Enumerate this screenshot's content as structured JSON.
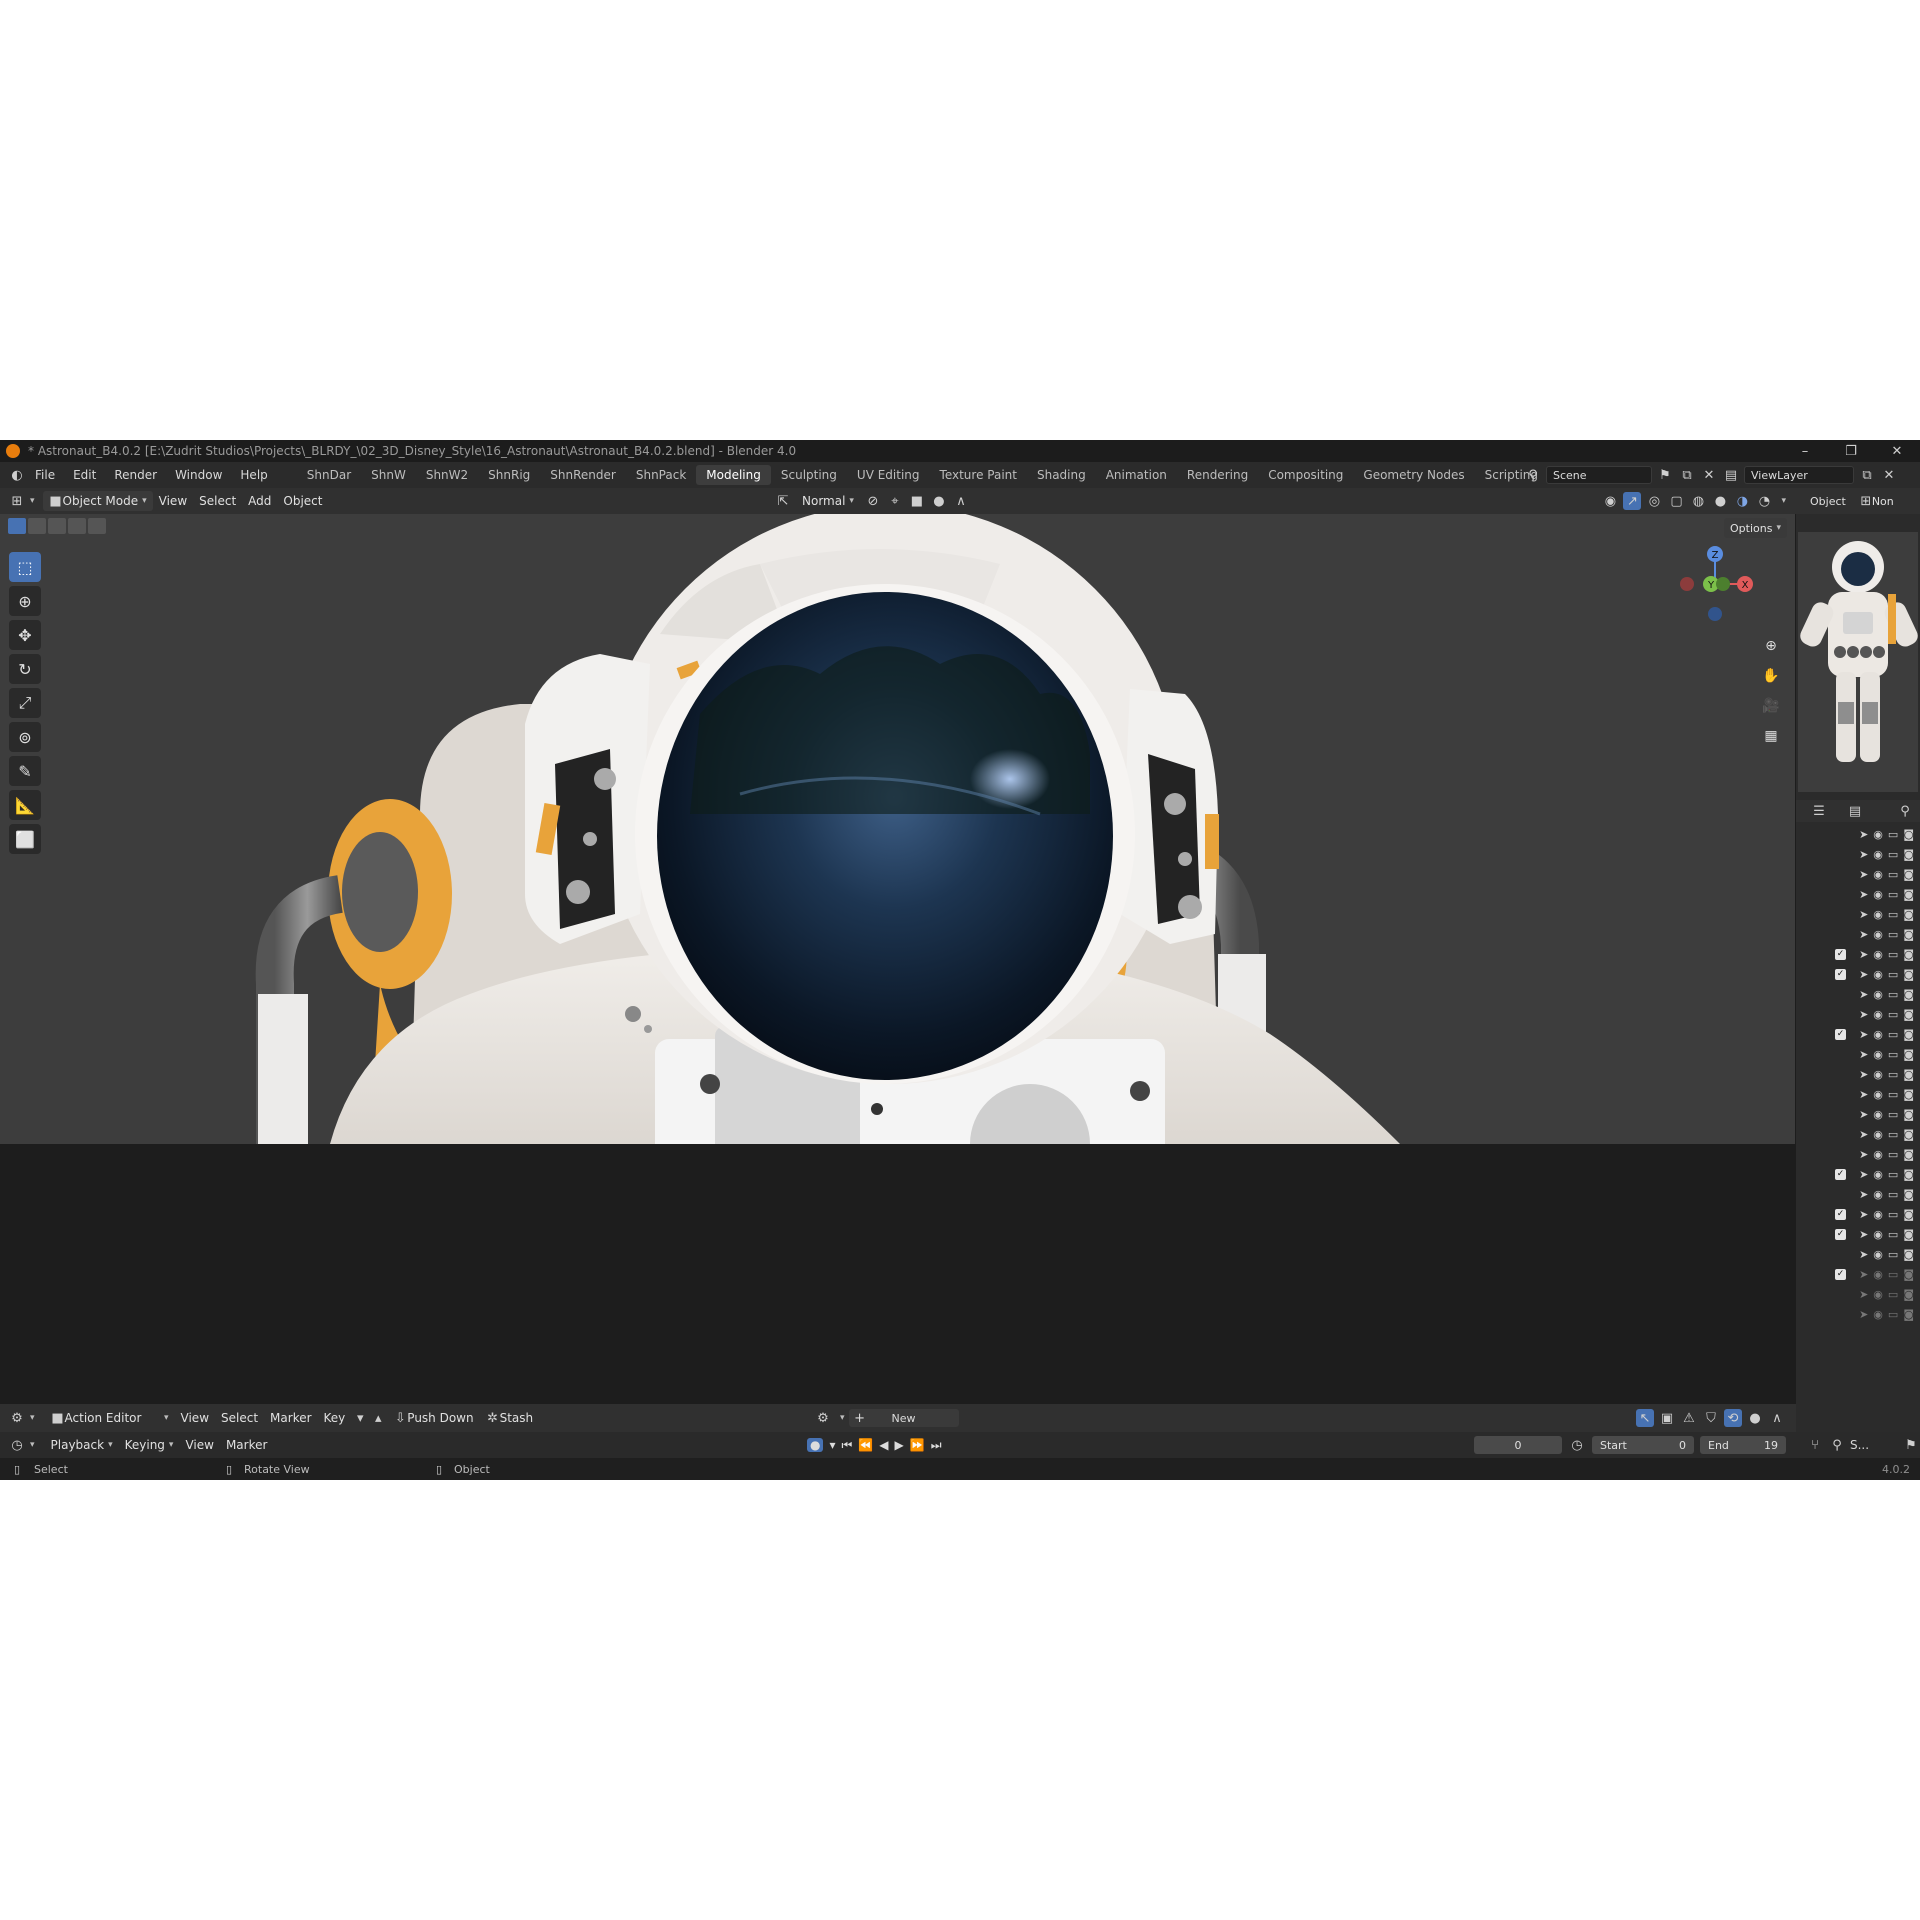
{
  "window": {
    "title": "* Astronaut_B4.0.2 [E:\\Zudrit Studios\\Projects\\_BLRDY_\\02_3D_Disney_Style\\16_Astronaut\\Astronaut_B4.0.2.blend] - Blender 4.0",
    "controls": [
      "–",
      "❐",
      "✕"
    ]
  },
  "menu": [
    "File",
    "Edit",
    "Render",
    "Window",
    "Help"
  ],
  "workspaces": [
    {
      "label": "ShnDar",
      "active": false
    },
    {
      "label": "ShnW",
      "active": false
    },
    {
      "label": "ShnW2",
      "active": false
    },
    {
      "label": "ShnRig",
      "active": false
    },
    {
      "label": "ShnRender",
      "active": false
    },
    {
      "label": "ShnPack",
      "active": false
    },
    {
      "label": "Modeling",
      "active": true
    },
    {
      "label": "Sculpting",
      "active": false
    },
    {
      "label": "UV Editing",
      "active": false
    },
    {
      "label": "Texture Paint",
      "active": false
    },
    {
      "label": "Shading",
      "active": false
    },
    {
      "label": "Animation",
      "active": false
    },
    {
      "label": "Rendering",
      "active": false
    },
    {
      "label": "Compositing",
      "active": false
    },
    {
      "label": "Geometry Nodes",
      "active": false
    },
    {
      "label": "Scripting",
      "active": false
    }
  ],
  "scene": {
    "name": "Scene",
    "view_layer": "ViewLayer"
  },
  "viewport_header": {
    "mode": "Object Mode",
    "menus": [
      "View",
      "Select",
      "Add",
      "Object"
    ],
    "orientation": "Normal",
    "options": "Options"
  },
  "properties": {
    "tab1": "Object",
    "tab2": "Non"
  },
  "gizmo": {
    "z": "Z",
    "y": "Y",
    "x": "X"
  },
  "outliner_rows": [
    {
      "check": false
    },
    {
      "check": false
    },
    {
      "check": false
    },
    {
      "check": false
    },
    {
      "check": false
    },
    {
      "check": false
    },
    {
      "check": true
    },
    {
      "check": true
    },
    {
      "check": false
    },
    {
      "check": false
    },
    {
      "check": true
    },
    {
      "check": false
    },
    {
      "check": false
    },
    {
      "check": false
    },
    {
      "check": false
    },
    {
      "check": false
    },
    {
      "check": false
    },
    {
      "check": true
    },
    {
      "check": false
    },
    {
      "check": true
    },
    {
      "check": true
    },
    {
      "check": false
    },
    {
      "check": true
    },
    {
      "check": false
    },
    {
      "check": false
    }
  ],
  "dopesheet": {
    "mode": "Action Editor",
    "menus": [
      "View",
      "Select",
      "Marker",
      "Key"
    ],
    "push_down": "Push Down",
    "stash": "Stash",
    "new": "New"
  },
  "timeline": {
    "menus": [
      "Playback",
      "Keying",
      "View",
      "Marker"
    ],
    "current_frame": "0",
    "start_label": "Start",
    "start": "0",
    "end_label": "End",
    "end": "19",
    "right_label": "S..."
  },
  "status": {
    "select": "Select",
    "rotate": "Rotate View",
    "object": "Object",
    "version": "4.0.2"
  },
  "colors": {
    "accent": "#4772b3",
    "orange": "#e8a33a",
    "suit": "#eeeae6"
  }
}
